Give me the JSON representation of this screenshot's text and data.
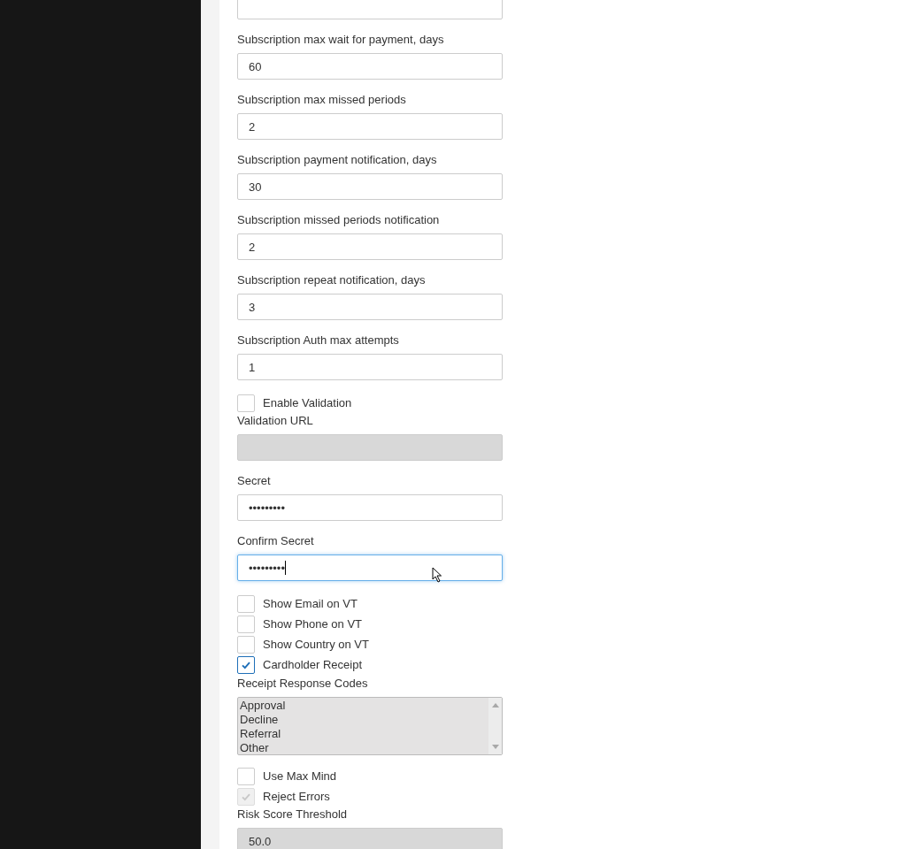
{
  "form": [
    {
      "kind": "field",
      "disabled": false,
      "focused": false
    },
    {
      "kind": "field",
      "label": "Subscription max wait for payment, days",
      "value": "60",
      "disabled": false,
      "focused": false
    },
    {
      "kind": "field",
      "label": "Subscription max missed periods",
      "value": "2",
      "disabled": false,
      "focused": false
    },
    {
      "kind": "field",
      "label": "Subscription payment notification, days",
      "value": "30",
      "disabled": false,
      "focused": false
    },
    {
      "kind": "field",
      "label": "Subscription missed periods notification",
      "value": "2",
      "disabled": false,
      "focused": false
    },
    {
      "kind": "field",
      "label": "Subscription repeat notification, days",
      "value": "3",
      "disabled": false,
      "focused": false
    },
    {
      "kind": "field",
      "label": "Subscription Auth max attempts",
      "value": "1",
      "disabled": false,
      "focused": false
    },
    {
      "kind": "checkbox",
      "label": "Enable Validation",
      "checked": false,
      "disabled": false
    },
    {
      "kind": "field",
      "label": "Validation URL",
      "disabled": true,
      "focused": false
    },
    {
      "kind": "field",
      "label": "Secret",
      "value": "•••••••••",
      "disabled": false,
      "focused": false
    },
    {
      "kind": "field",
      "label": "Confirm Secret",
      "value": "•••••••••",
      "disabled": false,
      "focused": true
    },
    {
      "kind": "checkbox",
      "label": "Show Email on VT",
      "checked": false,
      "disabled": false
    },
    {
      "kind": "checkbox",
      "label": "Show Phone on VT",
      "checked": false,
      "disabled": false
    },
    {
      "kind": "checkbox",
      "label": "Show Country on VT",
      "checked": false,
      "disabled": false
    },
    {
      "kind": "checkbox",
      "label": "Cardholder Receipt",
      "checked": true,
      "disabled": false
    },
    {
      "kind": "listbox",
      "label": "Receipt Response Codes",
      "disabled": true,
      "options": [
        "Approval",
        "Decline",
        "Referral",
        "Other"
      ]
    },
    {
      "kind": "checkbox",
      "label": "Use Max Mind",
      "checked": false,
      "disabled": false
    },
    {
      "kind": "checkbox",
      "label": "Reject Errors",
      "checked": true,
      "disabled": true
    },
    {
      "kind": "field",
      "label": "Risk Score Threshold",
      "value": "50.0",
      "disabled": true,
      "focused": false
    }
  ]
}
